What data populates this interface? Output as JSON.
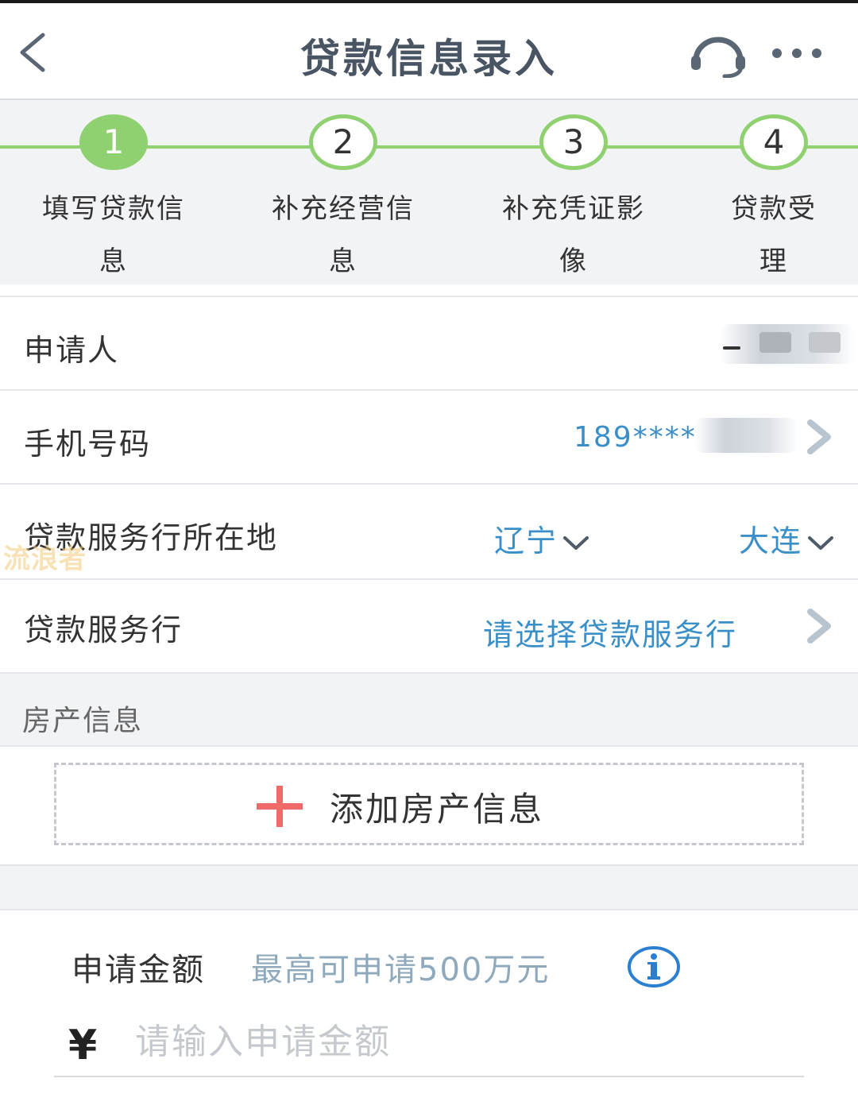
{
  "header": {
    "title": "贷款信息录入",
    "back_icon": "chevron-left-icon",
    "headset_icon": "headset-icon",
    "more_icon": "more-horizontal-icon"
  },
  "steps": [
    {
      "number": "1",
      "label_line1": "填写贷款信",
      "label_line2": "息",
      "active": true
    },
    {
      "number": "2",
      "label_line1": "补充经营信",
      "label_line2": "息",
      "active": false
    },
    {
      "number": "3",
      "label_line1": "补充凭证影",
      "label_line2": "像",
      "active": false
    },
    {
      "number": "4",
      "label_line1": "贷款受",
      "label_line2": "理",
      "active": false
    }
  ],
  "form": {
    "applicant": {
      "label": "申请人",
      "value_blurred": true
    },
    "phone": {
      "label": "手机号码",
      "value": "189****"
    },
    "location": {
      "label": "贷款服务行所在地",
      "province": "辽宁",
      "city": "大连"
    },
    "bank": {
      "label": "贷款服务行",
      "placeholder": "请选择贷款服务行"
    }
  },
  "property": {
    "section_title": "房产信息",
    "add_label": "添加房产信息"
  },
  "amount": {
    "label": "申请金额",
    "hint": "最高可申请500万元",
    "currency": "¥",
    "placeholder": "请输入申请金额"
  },
  "watermark": "流浪者",
  "colors": {
    "accent_green": "#8fd170",
    "link_blue": "#3a8fc9",
    "hint_gray_blue": "#8ea8bc",
    "plus_red": "#f06a6a"
  }
}
